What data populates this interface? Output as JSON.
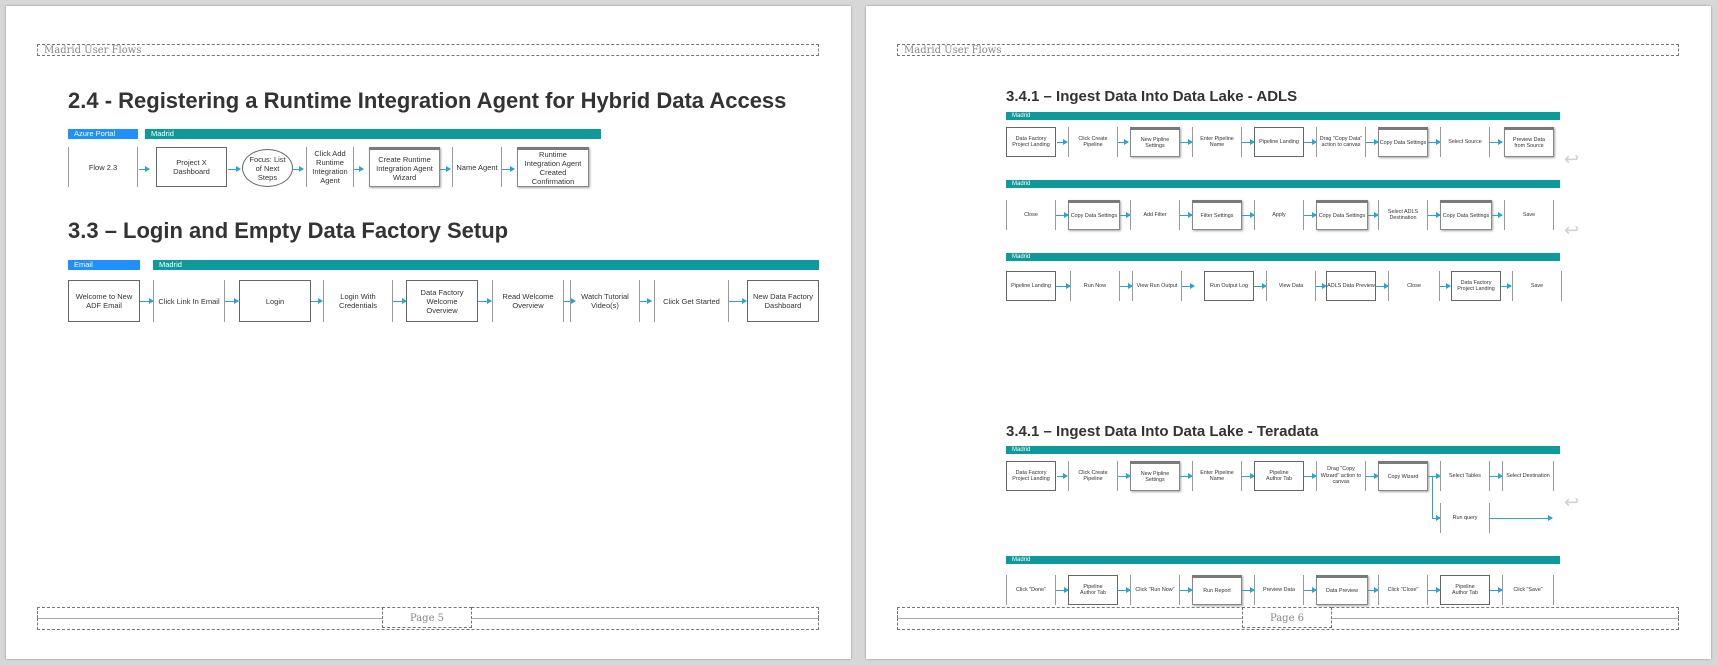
{
  "doc_header": "Madrid User Flows",
  "page_left": {
    "page_label": "Page 5",
    "sec24": {
      "title": "2.4 - Registering a Runtime Integration Agent for Hybrid Data Access",
      "lane_azure": "Azure Portal",
      "lane_madrid": "Madrid",
      "steps": [
        "Flow 2.3",
        "Project X Dashboard",
        "Focus: List of Next Steps",
        "Click Add Runtime Integration Agent",
        "Create Runtime Integration Agent Wizard",
        "Name Agent",
        "Runtime Integration Agent Created Confirmation"
      ]
    },
    "sec33": {
      "title": "3.3 – Login and Empty Data Factory Setup",
      "lane_email": "Email",
      "lane_madrid": "Madrid",
      "steps": [
        "Welcome to New ADF Email",
        "Click Link In Email",
        "Login",
        "Login With Credentials",
        "Data Factory Welcome Overview",
        "Read Welcome Overview",
        "Watch Tutorial Video(s)",
        "Click Get Started",
        "New Data Factory Dashboard"
      ]
    }
  },
  "page_right": {
    "page_label": "Page 6",
    "adls": {
      "title": "3.4.1 – Ingest Data Into Data Lake - ADLS",
      "lane_label": "Madrid",
      "row1": [
        "Data Factory Project Landing",
        "Click Create Pipeline",
        "New Pipline Settings",
        "Enter Pipeline Name",
        "Pipeline Landing",
        "Drag \"Copy Data\" action to canvas",
        "Copy Data Settings",
        "Select Source",
        "Preview Data from Source"
      ],
      "row2": [
        "Close",
        "Copy Data Settings",
        "Add Filter",
        "Filter Settings",
        "Apply",
        "Copy Data Settings",
        "Select ADLS Destination",
        "Copy Data Settings",
        "Save"
      ],
      "row3": [
        "Pipeline Landing",
        "Run Now",
        "View Run Output",
        "Run Output Log",
        "View Data",
        "ADLS Data Preview",
        "Close",
        "Data Factory Project Landing",
        "Save"
      ]
    },
    "teradata": {
      "title": "3.4.1 – Ingest Data Into Data Lake - Teradata",
      "lane_label": "Madrid",
      "row1": [
        "Data Factory Project Landing",
        "Click Create Pipeline",
        "New Pipline Settings",
        "Enter Pipeline Name",
        "Pipeline Author Tab",
        "Drag \"Copy Wizard\" action to canvas",
        "Copy Wizard",
        "Select Tables",
        "Select Destination"
      ],
      "branch": "Run query",
      "row2": [
        "Click \"Done\"",
        "Pipeline Author Tab",
        "Click \"Run Now\"",
        "Run Report",
        "Preview Data",
        "Data Preview",
        "Click \"Close\"",
        "Pipeline Author Tab",
        "Click \"Save\""
      ]
    }
  }
}
